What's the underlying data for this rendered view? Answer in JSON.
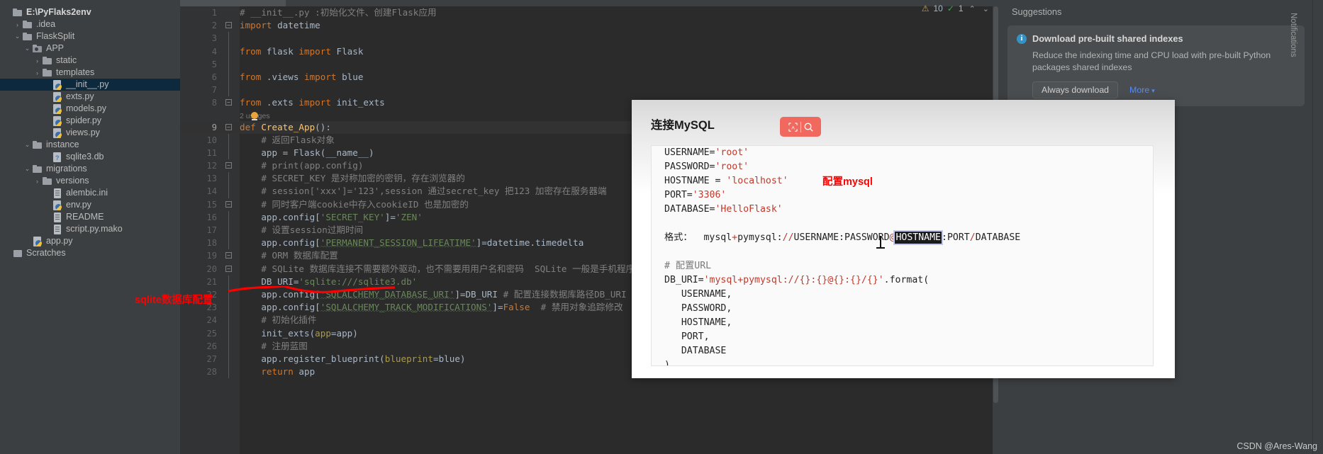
{
  "tree": {
    "root_label": "E:\\PyFlaks2env",
    "items": [
      {
        "label": "E:\\PyFlaks2env",
        "indent": 0,
        "arrow": "",
        "icon": "folder",
        "bold": true,
        "selected": false
      },
      {
        "label": ".idea",
        "indent": 1,
        "arrow": "collapsed",
        "icon": "folder",
        "bold": false,
        "selected": false
      },
      {
        "label": "FlaskSplit",
        "indent": 1,
        "arrow": "expanded",
        "icon": "folder",
        "bold": false,
        "selected": false
      },
      {
        "label": "APP",
        "indent": 2,
        "arrow": "expanded",
        "icon": "folder-module",
        "bold": false,
        "selected": false
      },
      {
        "label": "static",
        "indent": 3,
        "arrow": "collapsed",
        "icon": "folder",
        "bold": false,
        "selected": false
      },
      {
        "label": "templates",
        "indent": 3,
        "arrow": "collapsed",
        "icon": "folder",
        "bold": false,
        "selected": false
      },
      {
        "label": "__init__.py",
        "indent": 4,
        "arrow": "",
        "icon": "python",
        "bold": false,
        "selected": true
      },
      {
        "label": "exts.py",
        "indent": 4,
        "arrow": "",
        "icon": "python",
        "bold": false,
        "selected": false
      },
      {
        "label": "models.py",
        "indent": 4,
        "arrow": "",
        "icon": "python",
        "bold": false,
        "selected": false
      },
      {
        "label": "spider.py",
        "indent": 4,
        "arrow": "",
        "icon": "python",
        "bold": false,
        "selected": false
      },
      {
        "label": "views.py",
        "indent": 4,
        "arrow": "",
        "icon": "python",
        "bold": false,
        "selected": false
      },
      {
        "label": "instance",
        "indent": 2,
        "arrow": "expanded",
        "icon": "folder",
        "bold": false,
        "selected": false
      },
      {
        "label": "sqlite3.db",
        "indent": 4,
        "arrow": "",
        "icon": "db",
        "bold": false,
        "selected": false
      },
      {
        "label": "migrations",
        "indent": 2,
        "arrow": "expanded",
        "icon": "folder",
        "bold": false,
        "selected": false
      },
      {
        "label": "versions",
        "indent": 3,
        "arrow": "collapsed",
        "icon": "folder",
        "bold": false,
        "selected": false
      },
      {
        "label": "alembic.ini",
        "indent": 4,
        "arrow": "",
        "icon": "text",
        "bold": false,
        "selected": false
      },
      {
        "label": "env.py",
        "indent": 4,
        "arrow": "",
        "icon": "python",
        "bold": false,
        "selected": false
      },
      {
        "label": "README",
        "indent": 4,
        "arrow": "",
        "icon": "text",
        "bold": false,
        "selected": false
      },
      {
        "label": "script.py.mako",
        "indent": 4,
        "arrow": "",
        "icon": "text",
        "bold": false,
        "selected": false
      },
      {
        "label": "app.py",
        "indent": 2,
        "arrow": "",
        "icon": "python",
        "bold": false,
        "selected": false
      },
      {
        "label": "Scratches",
        "indent": 0,
        "arrow": "",
        "icon": "scratches",
        "bold": false,
        "selected": false
      }
    ]
  },
  "editor": {
    "inspection": {
      "warning_icon": "warning-triangle-icon",
      "warning_count": "10",
      "check_icon": "checkmark-icon",
      "check_count": "1",
      "up_caret": "⌃",
      "down_caret": "⌄"
    },
    "usages_hint": "2 usages",
    "lines": [
      {
        "n": "1",
        "html": "<span class='cmt'># __init__.py :初始化文件、创建Flask应用</span>"
      },
      {
        "n": "2",
        "html": "<span class='kw'>import</span><span class='pl'> datetime</span>"
      },
      {
        "n": "3",
        "html": ""
      },
      {
        "n": "4",
        "html": "<span class='kw'>from</span><span class='pl'> flask </span><span class='kw'>import</span><span class='pl'> Flask</span>"
      },
      {
        "n": "5",
        "html": ""
      },
      {
        "n": "6",
        "html": "<span class='kw'>from</span><span class='pl'> .views </span><span class='kw'>import</span><span class='pl'> blue</span>"
      },
      {
        "n": "7",
        "html": ""
      },
      {
        "n": "8",
        "html": "<span class='kw'>from</span><span class='pl'> .exts </span><span class='kw'>import</span><span class='pl'> init_exts</span>"
      },
      {
        "n": "9",
        "html": "<span class='kw'>def</span><span class='fn'> Create_App</span><span class='pl'>():</span>"
      },
      {
        "n": "10",
        "html": "    <span class='cmt'># 返回Flask对象</span>"
      },
      {
        "n": "11",
        "html": "    <span class='pl'>app = Flask(__name__)</span>"
      },
      {
        "n": "12",
        "html": "    <span class='cmt'># print(app.config)</span>"
      },
      {
        "n": "13",
        "html": "    <span class='cmt'># SECRET_KEY 是对称加密的密钥，存在浏览器的</span>"
      },
      {
        "n": "14",
        "html": "    <span class='cmt'># session['xxx']='123',session 通过secret_key 把123 加密存在服务器端</span>"
      },
      {
        "n": "15",
        "html": "    <span class='cmt'># 同时客户端cookie中存入cookieID 也是加密的</span>"
      },
      {
        "n": "16",
        "html": "    <span class='pl'>app.config[</span><span class='str'>'SECRET_KEY'</span><span class='pl'>]=</span><span class='str'>'ZEN'</span>"
      },
      {
        "n": "17",
        "html": "    <span class='cmt'># 设置session过期时间</span>"
      },
      {
        "n": "18",
        "html": "    <span class='pl'>app.config[</span><span class='str wavy'>'PERMANENT_SESSION_LIFEATIME'</span><span class='pl'>]=datetime.timedelta</span>"
      },
      {
        "n": "19",
        "html": "    <span class='cmt'># ORM 数据库配置</span>"
      },
      {
        "n": "20",
        "html": "    <span class='cmt'># SQLite 数据库连接不需要额外驱动，也不需要用用户名和密码  SQLite 一般是手机程序用的  本地数据库</span>"
      },
      {
        "n": "21",
        "html": "    <span class='pl'>DB_URI=</span><span class='str'>'sqlite:///sqlite3.db'</span>"
      },
      {
        "n": "22",
        "html": "    <span class='pl'>app.config[</span><span class='str wavy'>'SQLALCHEMY_DATABASE_URI'</span><span class='pl'>]=DB_URI</span><span class='cmt'> # 配置连接数据库路径DB_URI</span>"
      },
      {
        "n": "23",
        "html": "    <span class='pl'>app.config[</span><span class='str wavy'>'SQLALCHEMY_TRACK_MODIFICATIONS'</span><span class='pl'>]=</span><span class='kw'>False</span><span class='cmt'>  # 禁用对象追踪修改</span>"
      },
      {
        "n": "24",
        "html": "    <span class='cmt'># 初始化插件</span>"
      },
      {
        "n": "25",
        "html": "    <span class='pl'>init_exts(</span><span class='param'>app</span><span class='pl'>=app)</span>"
      },
      {
        "n": "26",
        "html": "    <span class='cmt'># 注册蓝图</span>"
      },
      {
        "n": "27",
        "html": "    <span class='pl'>app.register_blueprint(</span><span class='param'>blueprint</span><span class='pl'>=blue)</span>"
      },
      {
        "n": "28",
        "html": "    <span class='kw'>return</span><span class='pl'> app</span>"
      }
    ]
  },
  "suggestions": {
    "panel_title": "Suggestions",
    "card": {
      "icon": "info-icon",
      "title": "Download pre-built shared indexes",
      "body": "Reduce the indexing time and CPU load with pre-built Python packages shared indexes",
      "primary_button": "Always download",
      "secondary_link": "More",
      "secondary_caret": "▾"
    }
  },
  "notifications_strip": {
    "label": "Notifications"
  },
  "mysql_dialog": {
    "title": "连接MySQL",
    "tool_ai_icon": "ai-translate-icon",
    "tool_search_icon": "search-icon",
    "code_lines": [
      {
        "html": "USERNAME=<span class='ms'>'root'</span>"
      },
      {
        "html": "PASSWORD=<span class='ms'>'root'</span>"
      },
      {
        "html": "HOSTNAME = <span class='ms'>'localhost'</span>"
      },
      {
        "html": "PORT=<span class='ms'>'3306'</span>"
      },
      {
        "html": "DATABASE=<span class='ms'>'HelloFlask'</span>"
      },
      {
        "html": ""
      },
      {
        "html": "格式：  mysql<span class='mop'>+</span>pymysql<span class='mgray'>:</span><span class='mop'>//</span>USERNAME<span class='mgray'>:</span>PASSWORD<span class='mop'>@</span><span class='sel-hostname'>HOSTNAME</span><span class='mgray'>:</span>PORT<span class='mop'>/</span>DATABASE"
      },
      {
        "html": ""
      },
      {
        "html": "<span class='mcmt'># 配置URL</span>"
      },
      {
        "html": "DB_URI=<span class='ms'>'mysql+pymysql://{}:{}@{}:{}/{}'</span>.format("
      },
      {
        "html": "   USERNAME,"
      },
      {
        "html": "   PASSWORD,"
      },
      {
        "html": "   HOSTNAME,"
      },
      {
        "html": "   PORT,"
      },
      {
        "html": "   DATABASE"
      },
      {
        "html": ")"
      }
    ]
  },
  "annotations": {
    "sqlite_note": "sqlite数据库配置",
    "mysql_note": "配置mysql",
    "underline_color": "#ff0000"
  },
  "watermark": "CSDN @Ares-Wang"
}
